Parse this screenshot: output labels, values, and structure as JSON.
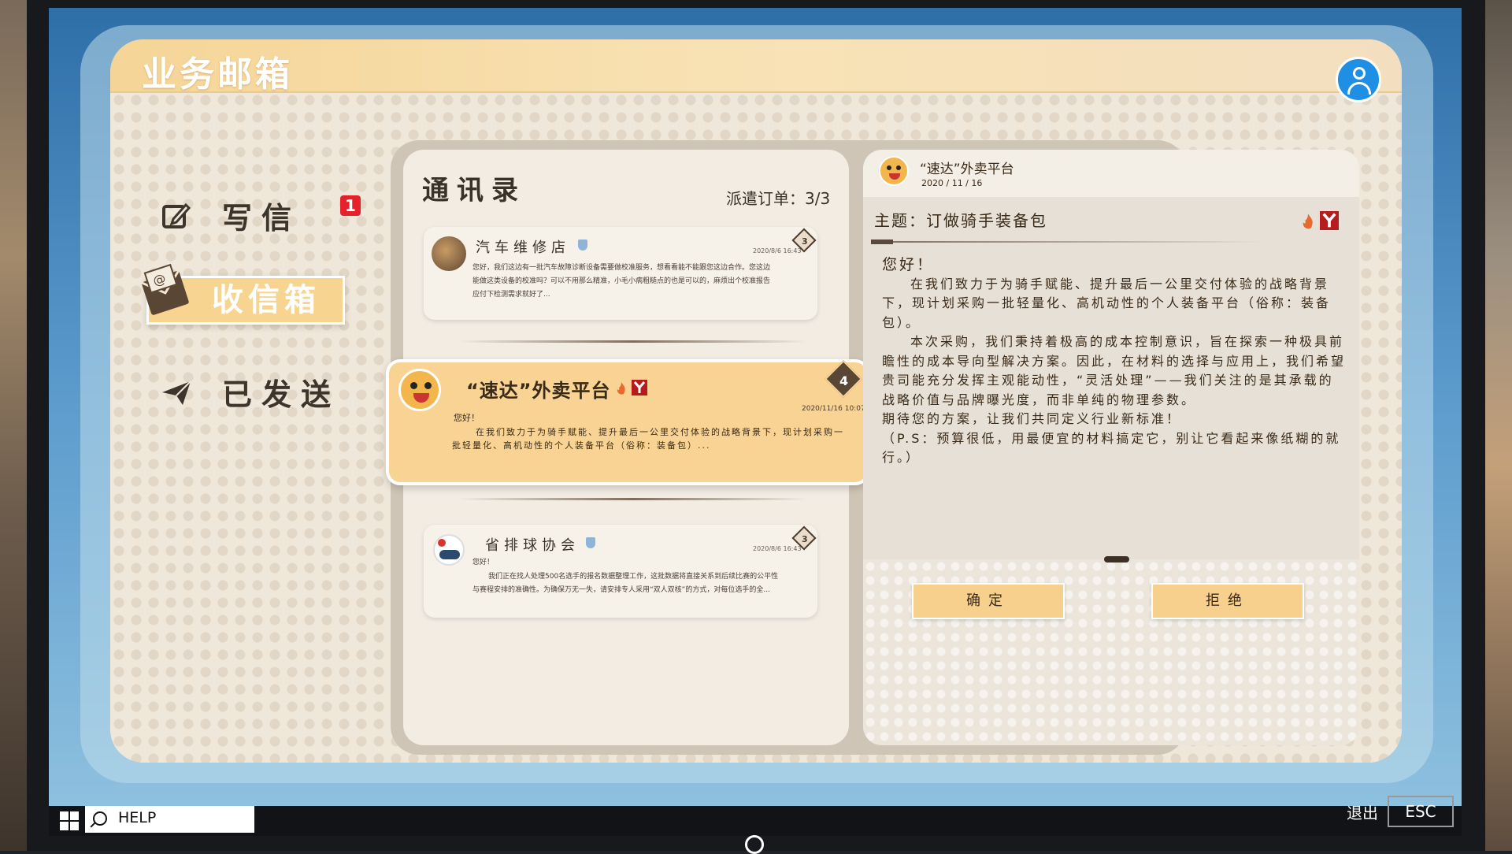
{
  "header": {
    "title": "业务邮箱"
  },
  "menu": {
    "write": {
      "label": "写信",
      "badge": "1"
    },
    "inbox": {
      "label": "收信箱"
    },
    "sent": {
      "label": "已发送"
    }
  },
  "contacts": {
    "title": "通讯录",
    "dispatch": "派遣订单：3/3",
    "items": [
      {
        "name": "汽车维修店",
        "date": "2020/8/6 16:43",
        "level": "3",
        "body": "您好，我们这边有一批汽车故障诊断设备需要做校准服务，想看看能不能跟您这边合作。您这边能做这类设备的校准吗？可以不用那么精准，小毛小病粗糙点的也是可以的，麻烦出个校准报告应付下检测需求就好了..."
      },
      {
        "name": "“速达”外卖平台",
        "date": "2020/11/16 10:07",
        "level": "4",
        "greeting": "您好！",
        "body": "在我们致力于为骑手赋能、提升最后一公里交付体验的战略背景下，现计划采购一批轻量化、高机动性的个人装备平台（俗称：装备包）..."
      },
      {
        "name": "省排球协会",
        "date": "2020/8/6 16:43",
        "level": "3",
        "greeting": "您好！",
        "body": "我们正在找人处理500名选手的报名数据整理工作，这批数据将直接关系到后续比赛的公平性与赛程安排的准确性。为确保万无一失，请安排专人采用“双人双核”的方式，对每位选手的全..."
      }
    ]
  },
  "detail": {
    "sender": "“速达”外卖平台",
    "date": "2020 / 11 / 16",
    "subject": "主题：订做骑手装备包",
    "greeting": "您好！",
    "paragraphs": [
      "在我们致力于为骑手赋能、提升最后一公里交付体验的战略背景下，现计划采购一批轻量化、高机动性的个人装备平台（俗称：装备包）。",
      "本次采购，我们秉持着极高的成本控制意识，旨在探索一种极具前瞻性的成本导向型解决方案。因此，在材料的选择与应用上，我们希望贵司能充分发挥主观能动性，“灵活处理”——我们关注的是其承载的战略价值与品牌曝光度，而非单纯的物理参数。",
      "期待您的方案，让我们共同定义行业新标准！",
      "（P.S：预算很低，用最便宜的材料搞定它，别让它看起来像纸糊的就行。）"
    ],
    "confirm_label": "确定",
    "reject_label": "拒绝"
  },
  "taskbar": {
    "help": "HELP",
    "exit": "退出",
    "esc": "ESC"
  },
  "colors": {
    "accent": "#f8d394",
    "badge": "#e5222a",
    "avatar": "#1f8fe6"
  }
}
